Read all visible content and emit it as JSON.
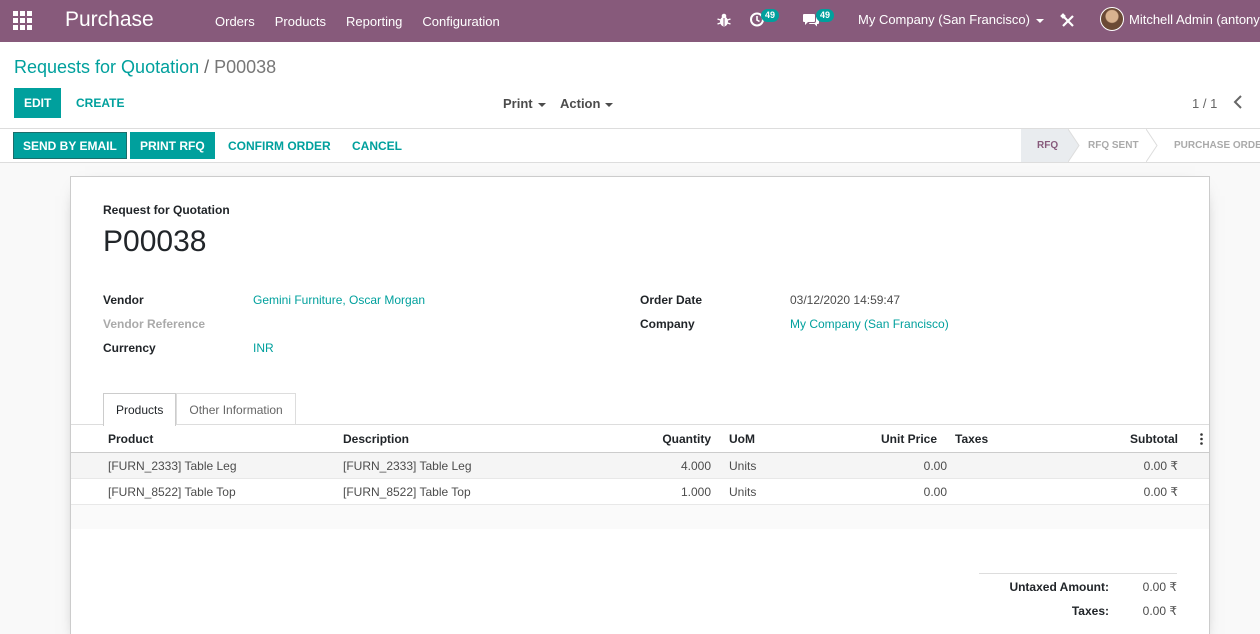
{
  "navbar": {
    "app_name": "Purchase",
    "menu": [
      "Orders",
      "Products",
      "Reporting",
      "Configuration"
    ],
    "activity_count": "49",
    "message_count": "49",
    "company": "My Company (San Francisco)",
    "user": "Mitchell Admin (antony"
  },
  "control": {
    "breadcrumb_parent": "Requests for Quotation",
    "breadcrumb_sep": "/",
    "breadcrumb_current": "P00038",
    "edit_label": "EDIT",
    "create_label": "CREATE",
    "print_label": "Print",
    "action_label": "Action",
    "pager": "1 / 1"
  },
  "statusbar": {
    "send_email": "SEND BY EMAIL",
    "print_rfq": "PRINT RFQ",
    "confirm_order": "CONFIRM ORDER",
    "cancel": "CANCEL",
    "stages": [
      "RFQ",
      "RFQ SENT",
      "PURCHASE ORDER"
    ],
    "active_stage": "RFQ"
  },
  "form": {
    "doc_label": "Request for Quotation",
    "doc_name": "P00038",
    "vendor_label": "Vendor",
    "vendor": "Gemini Furniture, Oscar Morgan",
    "vendor_ref_label": "Vendor Reference",
    "currency_label": "Currency",
    "currency": "INR",
    "order_date_label": "Order Date",
    "order_date": "03/12/2020 14:59:47",
    "company_label": "Company",
    "company": "My Company (San Francisco)",
    "tabs": [
      "Products",
      "Other Information"
    ]
  },
  "lines": {
    "columns": {
      "product": "Product",
      "description": "Description",
      "quantity": "Quantity",
      "uom": "UoM",
      "unit_price": "Unit Price",
      "taxes": "Taxes",
      "subtotal": "Subtotal"
    },
    "rows": [
      {
        "product": "[FURN_2333] Table Leg",
        "description": "[FURN_2333] Table Leg",
        "quantity": "4.000",
        "uom": "Units",
        "unit_price": "0.00",
        "taxes": "",
        "subtotal": "0.00 ₹"
      },
      {
        "product": "[FURN_8522] Table Top",
        "description": "[FURN_8522] Table Top",
        "quantity": "1.000",
        "uom": "Units",
        "unit_price": "0.00",
        "taxes": "",
        "subtotal": "0.00 ₹"
      }
    ]
  },
  "totals": {
    "untaxed_label": "Untaxed Amount:",
    "untaxed": "0.00 ₹",
    "taxes_label": "Taxes:",
    "taxes": "0.00 ₹"
  },
  "colors": {
    "brand": "#875a7b",
    "accent": "#00a09d"
  }
}
